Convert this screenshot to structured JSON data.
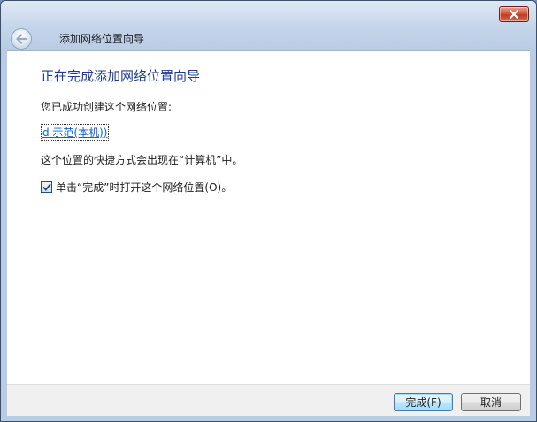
{
  "window": {
    "wizard_title": "添加网络位置向导"
  },
  "main": {
    "heading": "正在完成添加网络位置向导",
    "success_text": "您已成功创建这个网络位置:",
    "location_name": "d 示范(本机))",
    "shortcut_text": "这个位置的快捷方式会出现在“计算机”中。",
    "open_checkbox": {
      "label": "单击“完成”时打开这个网络位置(O)。",
      "checked": true
    }
  },
  "footer": {
    "finish_label": "完成(F)",
    "cancel_label": "取消"
  },
  "colors": {
    "heading": "#1f3c8c",
    "link": "#0a66cc",
    "close": "#c03c22"
  }
}
